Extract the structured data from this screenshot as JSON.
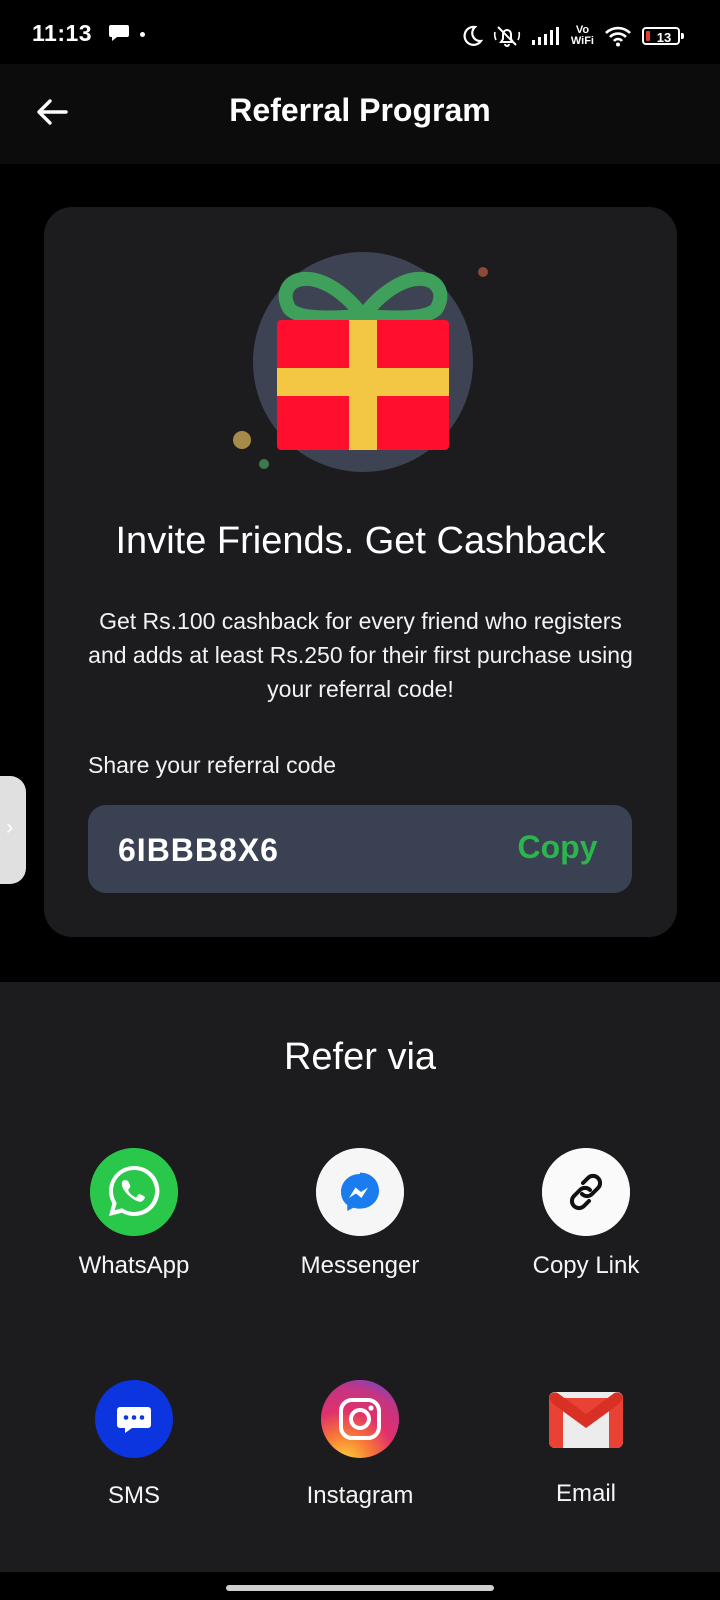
{
  "status_bar": {
    "time": "11:13",
    "network_label_top": "Vo",
    "network_label_bottom": "WiFi",
    "battery": "13"
  },
  "header": {
    "title": "Referral Program"
  },
  "card": {
    "headline": "Invite Friends. Get Cashback",
    "description": "Get Rs.100 cashback for every friend who registers and adds at least Rs.250 for their first purchase using your referral code!",
    "share_label": "Share your referral code",
    "referral_code": "6IBBB8X6",
    "copy_label": "Copy"
  },
  "refer_via": {
    "title": "Refer via",
    "options": [
      {
        "label": "WhatsApp",
        "icon": "whatsapp-icon"
      },
      {
        "label": "Messenger",
        "icon": "messenger-icon"
      },
      {
        "label": "Copy Link",
        "icon": "link-icon"
      },
      {
        "label": "SMS",
        "icon": "sms-icon"
      },
      {
        "label": "Instagram",
        "icon": "instagram-icon"
      },
      {
        "label": "Email",
        "icon": "gmail-icon"
      }
    ]
  },
  "colors": {
    "accent_green": "#2bb54c",
    "card_bg": "#1c1c1e",
    "code_box_bg": "#3a4152"
  }
}
